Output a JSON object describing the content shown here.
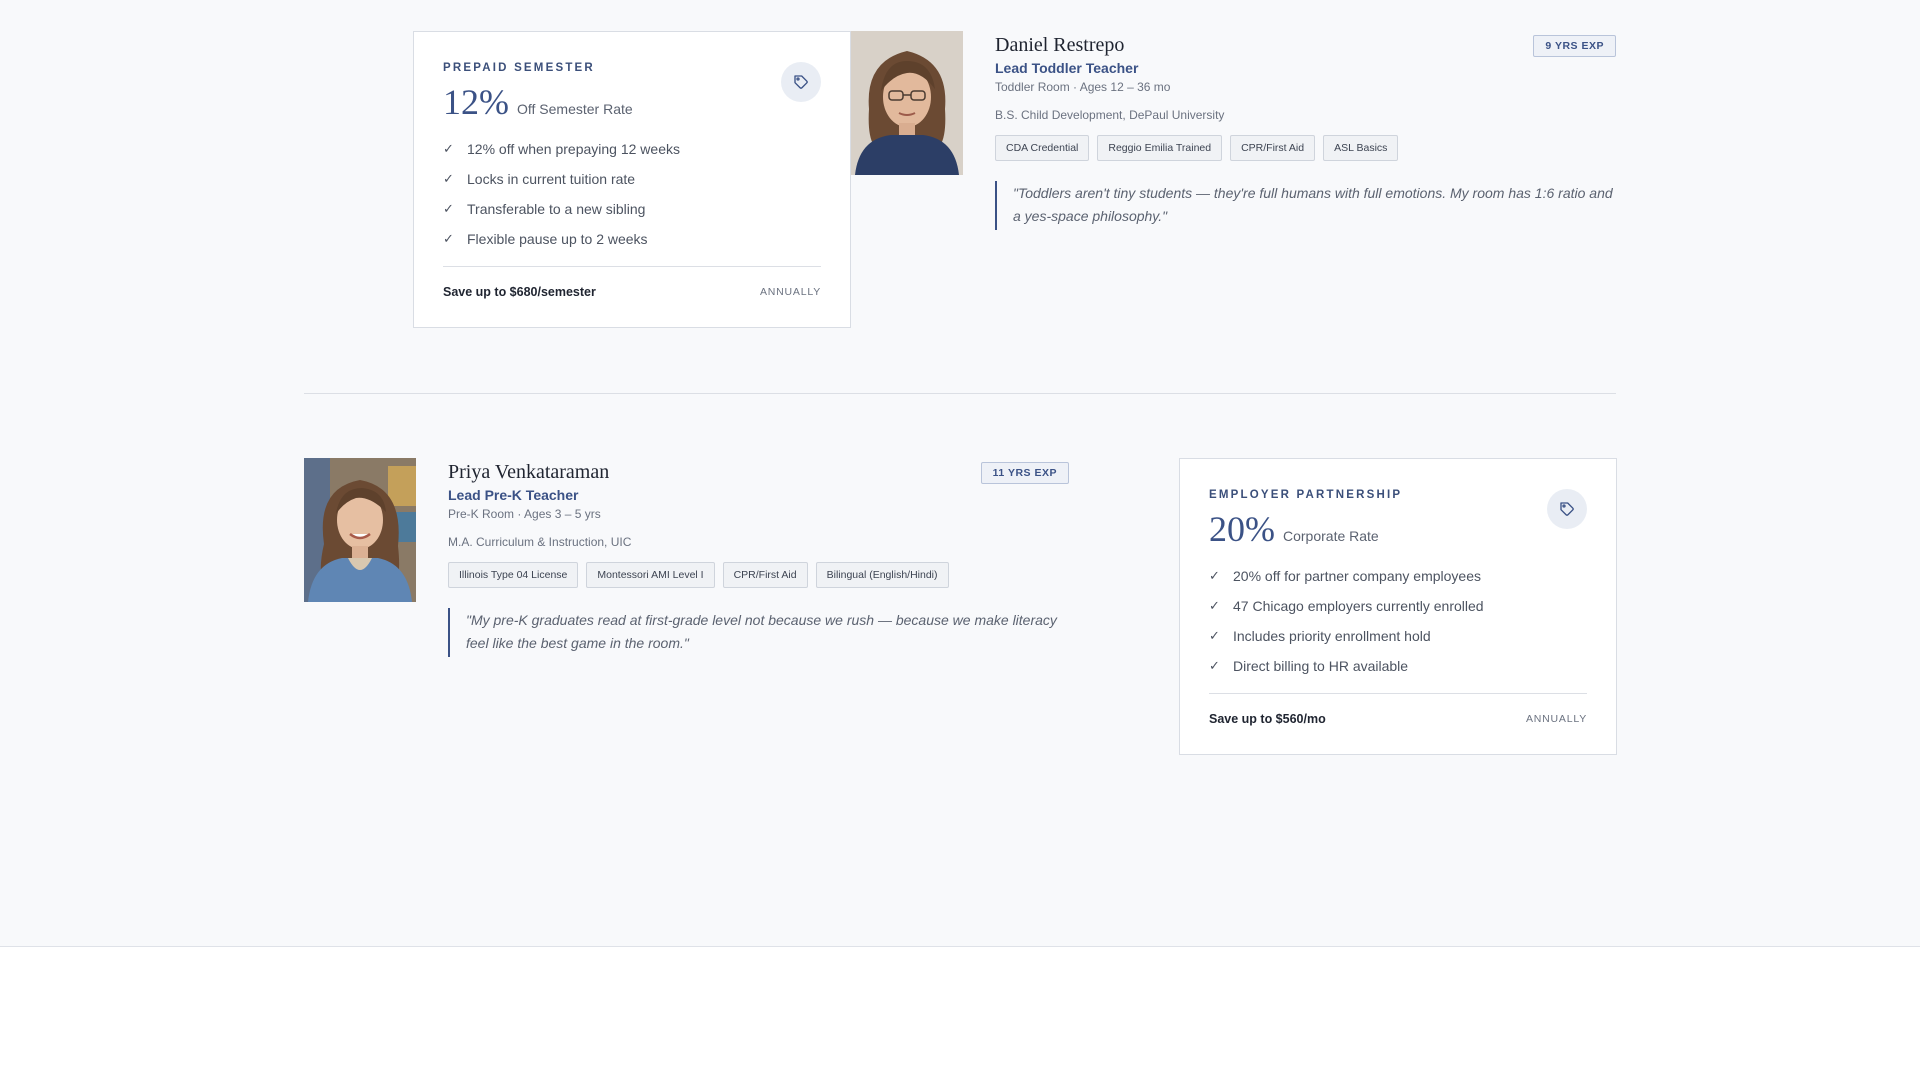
{
  "offers": [
    {
      "eyebrow": "PREPAID SEMESTER",
      "percent": "12%",
      "rate_label": "Off Semester Rate",
      "icon": "tag-icon",
      "items": [
        "12% off when prepaying 12 weeks",
        "Locks in current tuition rate",
        "Transferable to a new sibling",
        "Flexible pause up to 2 weeks"
      ],
      "savings": "Save up to $680/semester",
      "cycle": "ANNUALLY"
    },
    {
      "eyebrow": "EMPLOYER PARTNERSHIP",
      "percent": "20%",
      "rate_label": "Corporate Rate",
      "icon": "tag-icon",
      "items": [
        "20% off for partner company employees",
        "47 Chicago employers currently enrolled",
        "Includes priority enrollment hold",
        "Direct billing to HR available"
      ],
      "savings": "Save up to $560/mo",
      "cycle": "ANNUALLY"
    }
  ],
  "teachers": [
    {
      "name": "Daniel Restrepo",
      "experience": "9 YRS EXP",
      "role": "Lead Toddler Teacher",
      "room": "Toddler Room · Ages 12 – 36 mo",
      "education": "B.S. Child Development, DePaul University",
      "credentials": [
        "CDA Credential",
        "Reggio Emilia Trained",
        "CPR/First Aid",
        "ASL Basics"
      ],
      "quote": "\"Toddlers aren't tiny students — they're full humans with full emotions. My room has 1:6 ratio and a yes-space philosophy.\""
    },
    {
      "name": "Priya Venkataraman",
      "experience": "11 YRS EXP",
      "role": "Lead Pre-K Teacher",
      "room": "Pre-K Room · Ages 3 – 5 yrs",
      "education": "M.A. Curriculum & Instruction, UIC",
      "credentials": [
        "Illinois Type 04 License",
        "Montessori AMI Level I",
        "CPR/First Aid",
        "Bilingual (English/Hindi)"
      ],
      "quote": "\"My pre-K graduates read at first-grade level not because we rush — because we make literacy feel like the best game in the room.\""
    }
  ],
  "colors": {
    "accent": "#3b5286",
    "background": "#f8f9fb",
    "card": "#ffffff"
  }
}
